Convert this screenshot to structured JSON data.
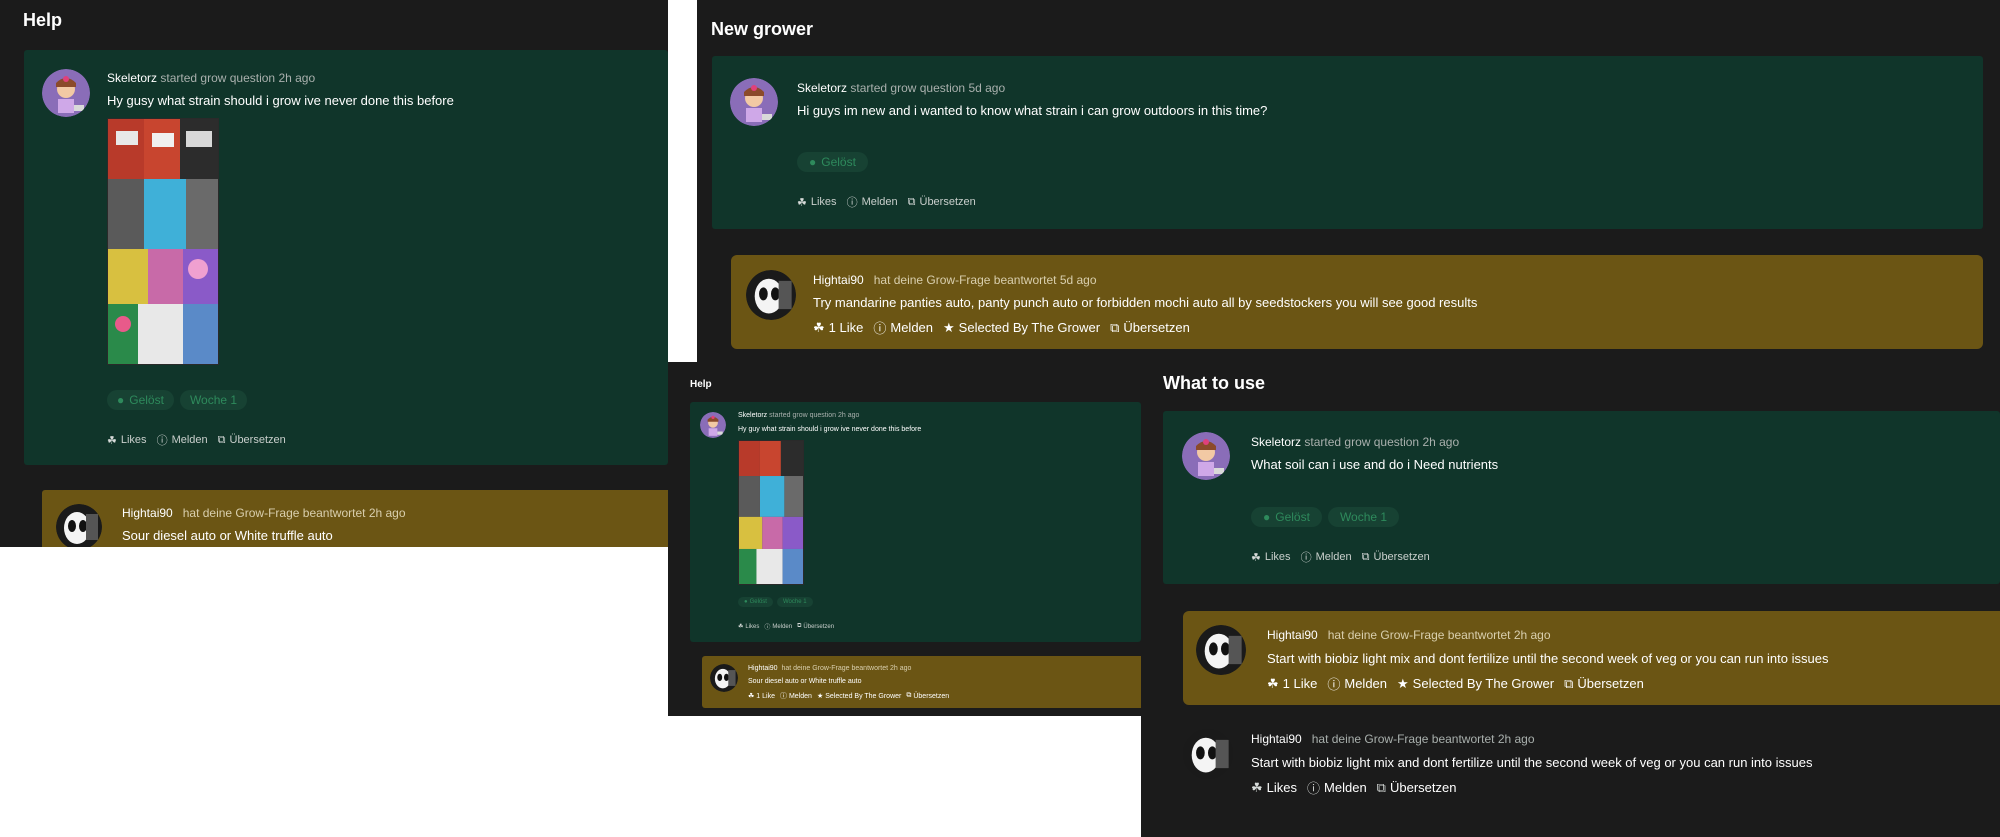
{
  "panel_help": {
    "title": "Help",
    "question": {
      "user": "Skeletorz",
      "meta": "started grow question 2h ago",
      "text": "Hy gusy what strain should i grow ive never done this before",
      "badges": [
        "Gelöst",
        "Woche 1"
      ],
      "actions": [
        "Likes",
        "Melden",
        "Übersetzen"
      ]
    },
    "answer": {
      "user": "Hightai90",
      "meta": "hat deine Grow-Frage beantwortet 2h ago",
      "text": "Sour diesel auto or White truffle auto"
    }
  },
  "panel_new_grower": {
    "title": "New grower",
    "question": {
      "user": "Skeletorz",
      "meta": "started grow question 5d ago",
      "text": "Hi guys im new and i wanted to know what strain i can grow outdoors in this time?",
      "badges": [
        "Gelöst"
      ],
      "actions": [
        "Likes",
        "Melden",
        "Übersetzen"
      ]
    },
    "answer": {
      "user": "Hightai90",
      "meta": "hat deine Grow-Frage beantwortet 5d ago",
      "text": "Try mandarine panties auto, panty punch auto or forbidden mochi auto all by seedstockers you will see good results",
      "actions": [
        "1 Like",
        "Melden",
        "Selected By The Grower",
        "Übersetzen"
      ]
    }
  },
  "panel_help_small": {
    "title": "Help",
    "question": {
      "user": "Skeletorz",
      "meta": "started grow question 2h ago",
      "text": "Hy guy what strain should i grow ive never done this before",
      "badges": [
        "Gelöst",
        "Woche 1"
      ],
      "actions": [
        "Likes",
        "Melden",
        "Übersetzen"
      ]
    },
    "answer": {
      "user": "Hightai90",
      "meta": "hat deine Grow-Frage beantwortet 2h ago",
      "text": "Sour diesel auto or White truffle auto",
      "actions": [
        "1 Like",
        "Melden",
        "Selected By The Grower",
        "Übersetzen"
      ]
    }
  },
  "panel_what_to_use": {
    "title": "What to use",
    "question": {
      "user": "Skeletorz",
      "meta": "started grow question 2h ago",
      "text": "What soil can i use and do i Need nutrients",
      "badges": [
        "Gelöst",
        "Woche 1"
      ],
      "actions": [
        "Likes",
        "Melden",
        "Übersetzen"
      ]
    },
    "answer": {
      "user": "Hightai90",
      "meta": "hat deine Grow-Frage beantwortet 2h ago",
      "text": "Start with biobiz light mix and dont fertilize until the second week of veg or you can run into issues",
      "actions": [
        "1 Like",
        "Melden",
        "Selected By The Grower",
        "Übersetzen"
      ]
    },
    "answer2": {
      "user": "Hightai90",
      "meta": "hat deine Grow-Frage beantwortet 2h ago",
      "text": "Start with biobiz light mix and dont fertilize until the second week of veg or you can run into issues",
      "actions": [
        "Likes",
        "Melden",
        "Übersetzen"
      ]
    }
  },
  "colors": {
    "panel_bg": "#1b1b1b",
    "question_bg": "#10352a",
    "answer_highlight_bg": "#6b5514",
    "badge_bg": "#174233",
    "badge_text": "#2e8a5c"
  }
}
